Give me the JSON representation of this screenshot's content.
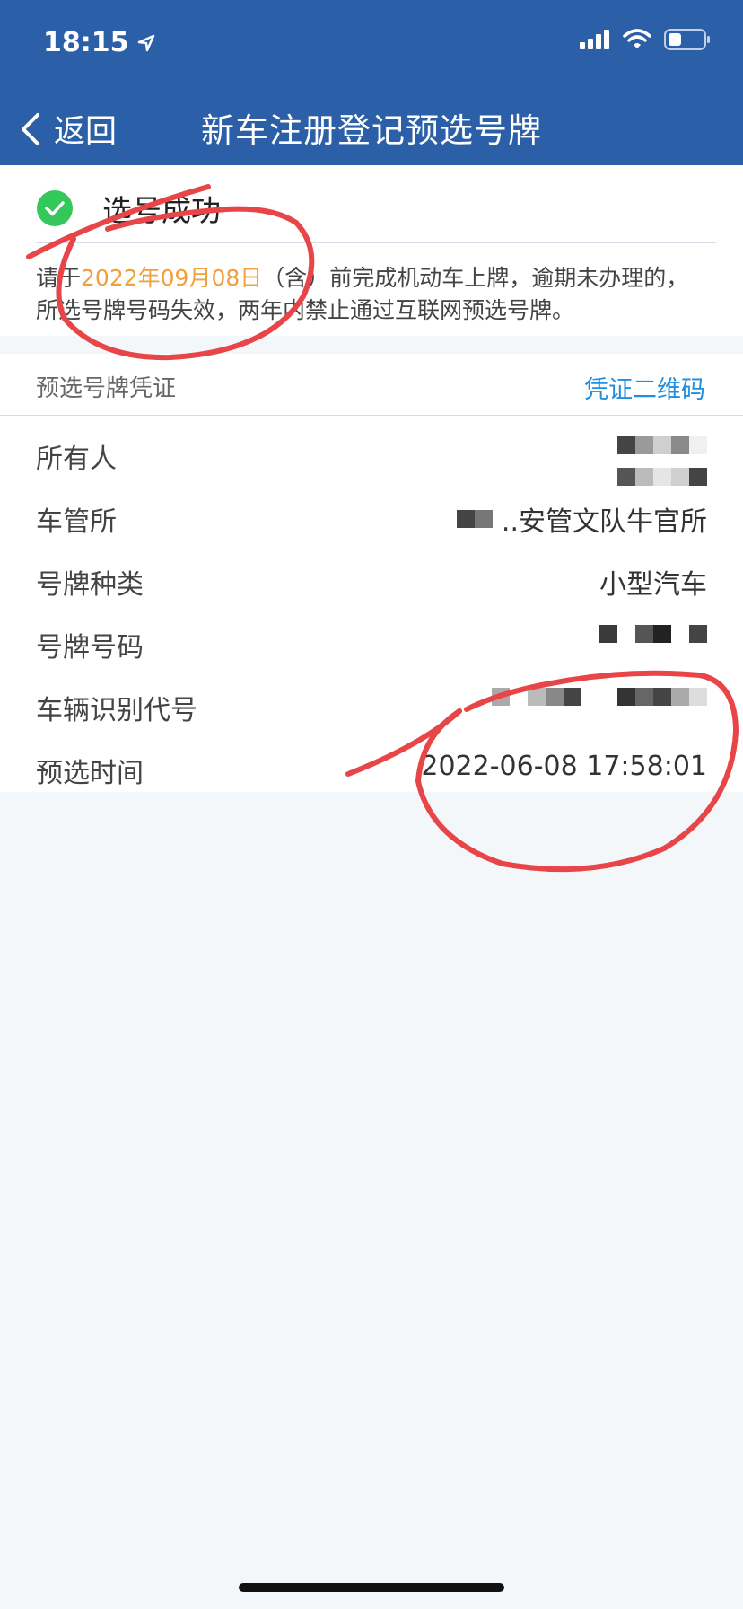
{
  "status_bar": {
    "time": "18:15"
  },
  "nav": {
    "back_label": "返回",
    "title": "新车注册登记预选号牌"
  },
  "result": {
    "status_text": "选号成功",
    "notice_prefix": "请于",
    "deadline": "2022年09月08日",
    "notice_suffix": "（含）前完成机动车上牌，逾期未办理的，所选号牌号码失效，两年内禁止通过互联网预选号牌。"
  },
  "certificate": {
    "title": "预选号牌凭证",
    "qr_link": "凭证二维码",
    "rows": [
      {
        "label": "所有人",
        "value": ""
      },
      {
        "label": "车管所",
        "value": "..安管文队牛官所"
      },
      {
        "label": "号牌种类",
        "value": "小型汽车"
      },
      {
        "label": "号牌号码",
        "value": ""
      },
      {
        "label": "车辆识别代号",
        "value": ""
      },
      {
        "label": "预选时间",
        "value": "2022-06-08 17:58:01"
      }
    ]
  },
  "colors": {
    "header": "#2b5fa8",
    "accent_orange": "#f0a03c",
    "link_blue": "#1f8fe0",
    "success_green": "#34c759",
    "annotation_red": "#e84548"
  }
}
